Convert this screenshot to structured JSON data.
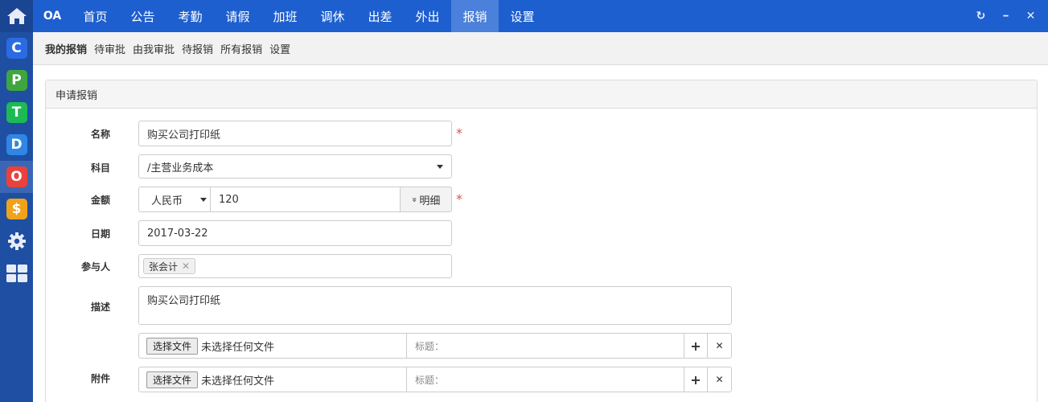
{
  "rail": {
    "apps": [
      {
        "glyph": "C",
        "color": "#2a6be3",
        "name": "app-c"
      },
      {
        "glyph": "P",
        "color": "#3fa63f",
        "name": "app-p"
      },
      {
        "glyph": "T",
        "color": "#1db954",
        "name": "app-t"
      },
      {
        "glyph": "D",
        "color": "#2f86e6",
        "name": "app-d"
      },
      {
        "glyph": "O",
        "color": "#e9423c",
        "name": "app-o"
      },
      {
        "glyph": "$",
        "color": "#f1a21b",
        "name": "app-s"
      }
    ]
  },
  "topbar": {
    "brand": "OA",
    "nav": [
      "首页",
      "公告",
      "考勤",
      "请假",
      "加班",
      "调休",
      "出差",
      "外出",
      "报销",
      "设置"
    ],
    "active_index": 8,
    "controls": {
      "refresh": "↻",
      "minimize": "━",
      "close": "✕"
    }
  },
  "subnav": {
    "items": [
      "我的报销",
      "待审批",
      "由我审批",
      "待报销",
      "所有报销",
      "设置"
    ],
    "active_index": 0
  },
  "panel": {
    "title": "申请报销"
  },
  "form": {
    "name": {
      "label": "名称",
      "value": "购买公司打印纸"
    },
    "subject": {
      "label": "科目",
      "value": "/主营业务成本"
    },
    "amount": {
      "label": "金额",
      "currency": "人民币",
      "value": "120",
      "detail_button": "明细",
      "detail_icon": "»"
    },
    "date": {
      "label": "日期",
      "value": "2017-03-22"
    },
    "participants": {
      "label": "参与人",
      "tags": [
        "张会计"
      ]
    },
    "description": {
      "label": "描述",
      "value": "购买公司打印纸"
    },
    "attachments": {
      "label": "附件",
      "rows": [
        {
          "choose_button": "选择文件",
          "no_file": "未选择任何文件",
          "title_placeholder": "标题："
        },
        {
          "choose_button": "选择文件",
          "no_file": "未选择任何文件",
          "title_placeholder": "标题："
        }
      ],
      "add_icon": "+",
      "remove_icon": "✕"
    },
    "required_mark": "*"
  }
}
